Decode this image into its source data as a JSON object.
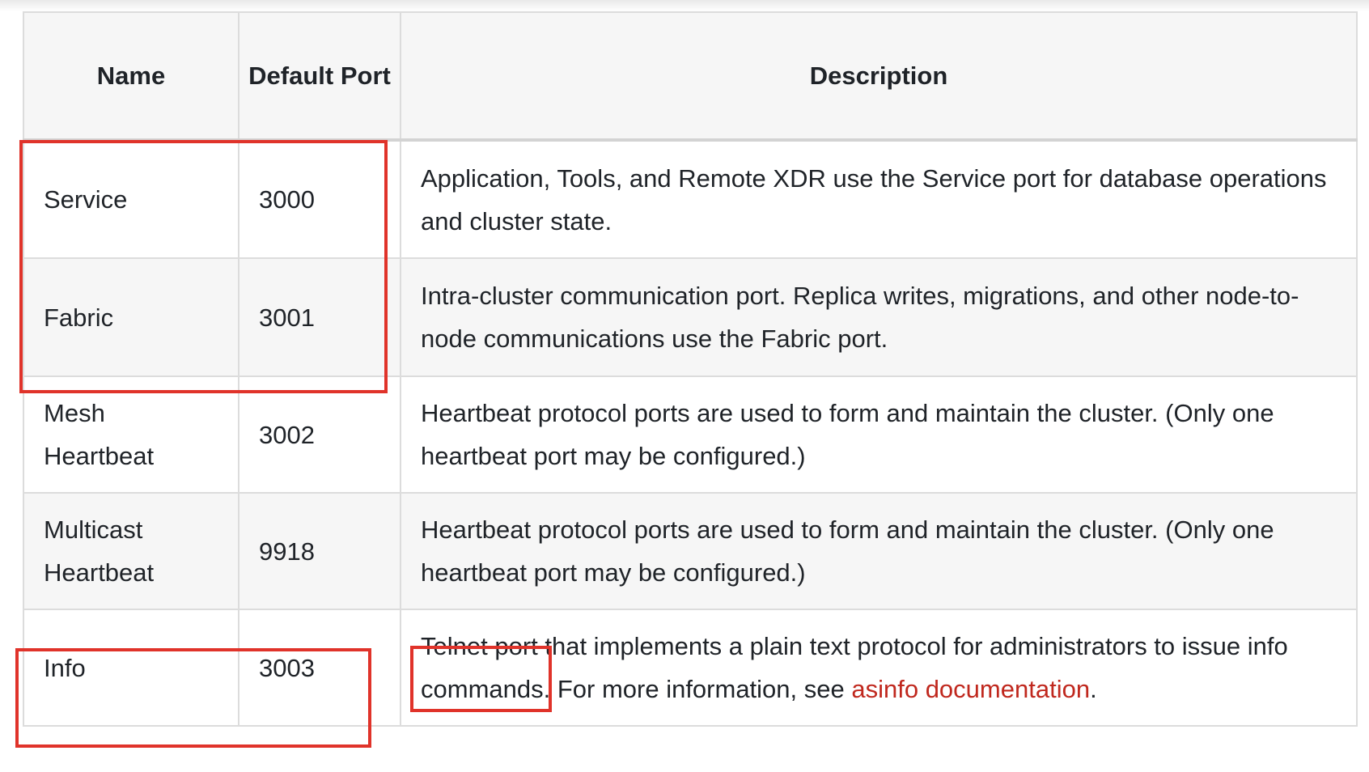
{
  "table": {
    "headers": {
      "name": "Name",
      "port": "Default Port",
      "description": "Description"
    },
    "rows": [
      {
        "name": "Service",
        "port": "3000",
        "description": "Application, Tools, and Remote XDR use the Service port for database operations and cluster state."
      },
      {
        "name": "Fabric",
        "port": "3001",
        "description": "Intra-cluster communication port. Replica writes, migrations, and other node-to-node communications use the Fabric port."
      },
      {
        "name": "Mesh Heartbeat",
        "port": "3002",
        "description": "Heartbeat protocol ports are used to form and maintain the cluster. (Only one heartbeat port may be configured.)"
      },
      {
        "name": "Multicast Heartbeat",
        "port": "9918",
        "description": "Heartbeat protocol ports are used to form and maintain the cluster. (Only one heartbeat port may be configured.)"
      },
      {
        "name": "Info",
        "port": "3003",
        "description_before": "Telnet port that implements a plain text protocol for administrators to issue info commands. For more information, see ",
        "description_link": "asinfo documentation",
        "description_after": "."
      }
    ]
  },
  "colors": {
    "highlight": "#e0332a",
    "link": "#c0281e",
    "header_bg": "#f6f6f6",
    "stripe_bg": "#f6f6f6",
    "border": "#dcdcdc"
  }
}
